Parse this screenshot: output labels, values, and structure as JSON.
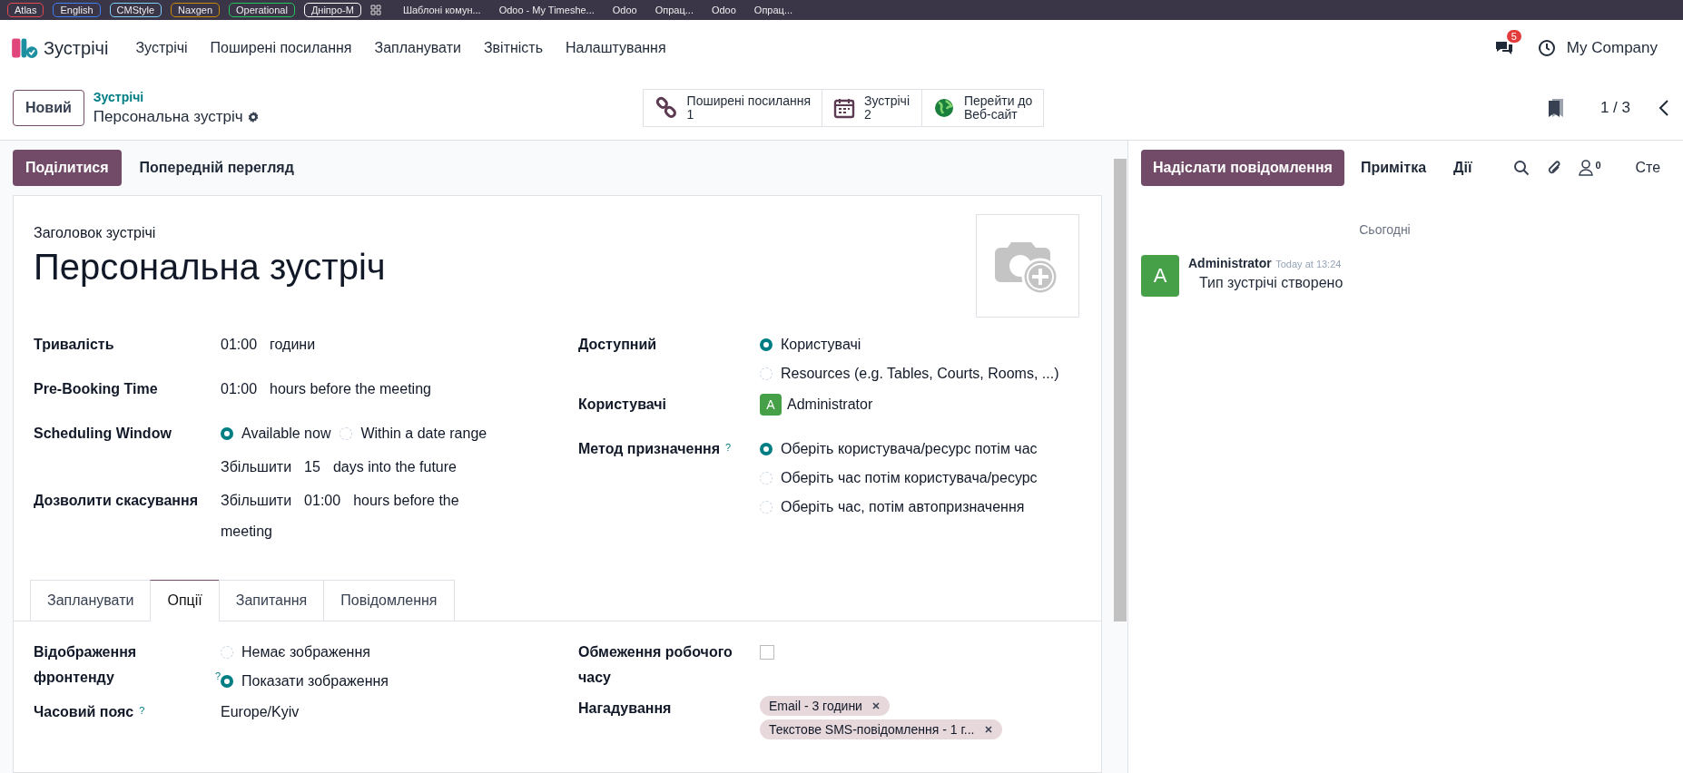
{
  "browser_bar": {
    "bookmarks": [
      {
        "label": "Atlas",
        "color": "#e5484d"
      },
      {
        "label": "English",
        "color": "#3b82f6"
      },
      {
        "label": "CMStyle",
        "color": "#7dd3fc"
      },
      {
        "label": "Naxgen",
        "color": "#ca8a04"
      },
      {
        "label": "Operational",
        "color": "#22c55e"
      },
      {
        "label": "Дніпро-М",
        "color": "#ffffff"
      }
    ],
    "tabs": [
      "Шаблоні комун...",
      "Odoo - My Timeshe...",
      "Odoo",
      "Опрац...",
      "Odoo",
      "Опрац..."
    ]
  },
  "navbar": {
    "app": "Зустрічі",
    "menu": [
      "Зустрічі",
      "Поширені посилання",
      "Запланувати",
      "Звітність",
      "Налаштування"
    ],
    "messages_badge": "5",
    "company": "My Company"
  },
  "control_panel": {
    "new_button": "Новий",
    "breadcrumb": "Зустрічі",
    "record": "Персональна зустріч",
    "smart_buttons": [
      {
        "kind": "link",
        "label": "Поширені посилання",
        "value": "1"
      },
      {
        "kind": "calendar",
        "label": "Зустрічі",
        "value": "2"
      },
      {
        "kind": "globe",
        "label": "Перейти до",
        "value": "Веб-сайт"
      }
    ],
    "pager": "1 / 3"
  },
  "form": {
    "actions": [
      {
        "label": "Поділитися",
        "kind": "primary"
      },
      {
        "label": "Попередній перегляд",
        "kind": "secondary"
      }
    ],
    "title_label": "Заголовок зустрічі",
    "title": "Персональна зустріч",
    "left_fields": [
      {
        "label": "Тривалість",
        "kind": "parts",
        "parts": [
          "01:00",
          "години"
        ]
      },
      {
        "label": "Pre-Booking Time",
        "kind": "parts",
        "parts": [
          "01:00",
          "hours before the meeting"
        ]
      },
      {
        "label": "Scheduling Window",
        "kind": "radio",
        "inline": true,
        "options": [
          {
            "label": "Available now",
            "selected": true
          },
          {
            "label": "Within a date range",
            "selected": false
          }
        ],
        "detail": [
          "Збільшити",
          "15",
          "days into the future"
        ]
      },
      {
        "label": "Дозволити скасування",
        "kind": "parts",
        "parts": [
          "Збільшити",
          "01:00",
          "hours before the meeting"
        ]
      }
    ],
    "right_fields": [
      {
        "label": "Доступний",
        "kind": "radio",
        "inline": false,
        "options": [
          {
            "label": "Користувачі",
            "selected": true
          },
          {
            "label": "Resources (e.g. Tables, Courts, Rooms, ...)",
            "selected": false
          }
        ]
      },
      {
        "label": "Користувачі",
        "kind": "user",
        "initial": "A",
        "name": "Administrator"
      },
      {
        "label": "Метод призначення",
        "help": "?",
        "kind": "radio",
        "inline": false,
        "options": [
          {
            "label": "Оберіть користувача/ресурс потім час",
            "selected": true
          },
          {
            "label": "Оберіть час потім користувача/ресурс",
            "selected": false
          },
          {
            "label": "Оберіть час, потім автопризначення",
            "selected": false
          }
        ]
      }
    ],
    "tabs": [
      {
        "label": "Запланувати",
        "selected": false
      },
      {
        "label": "Опції",
        "selected": true
      },
      {
        "label": "Запитання",
        "selected": false
      },
      {
        "label": "Повідомлення",
        "selected": false
      }
    ],
    "tab_left_fields": [
      {
        "label": "Відображення фронтенду",
        "help": "?",
        "kind": "radio",
        "inline": false,
        "options": [
          {
            "label": "Немає зображення",
            "selected": false
          },
          {
            "label": "Показати зображення",
            "selected": true
          }
        ]
      },
      {
        "label": "Часовий пояс",
        "help": "?",
        "kind": "parts",
        "parts": [
          "Europe/Kyiv"
        ]
      }
    ],
    "tab_right_fields": [
      {
        "label": "Обмеження робочого часу",
        "kind": "checkbox",
        "checked": false
      },
      {
        "label": "Нагадування",
        "kind": "tags",
        "tags": [
          "Email - 3 години",
          "Текстове SMS-повідомлення - 1 г..."
        ]
      }
    ]
  },
  "chatter": {
    "send_button": "Надіслати повідомлення",
    "note": "Примітка",
    "activities": "Дії",
    "followers": "0",
    "follow": "Сте",
    "date_separator": "Сьогодні",
    "messages": [
      {
        "initial": "A",
        "author": "Administrator",
        "time": "Today at 13:24",
        "body": "Тип зустрічі створено"
      }
    ]
  }
}
